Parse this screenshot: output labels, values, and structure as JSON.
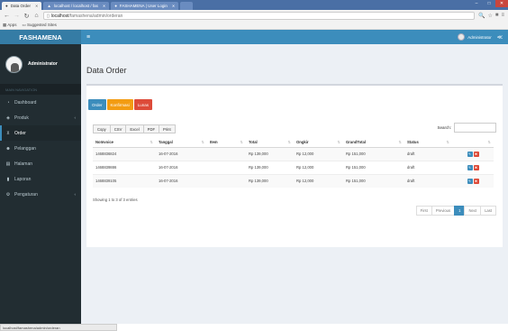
{
  "browser": {
    "tabs": [
      {
        "label": "Data Order",
        "active": true
      },
      {
        "label": "localhost / localhost / fas",
        "active": false
      },
      {
        "label": "FASHAMENA | User Login",
        "active": false
      }
    ],
    "url_host": "localhost",
    "url_path": "/famashena/admin/orderan",
    "bookmarks": [
      "Apps",
      "Suggested Sites"
    ],
    "status_url": "localhost/famashena/admin/orderan"
  },
  "header": {
    "brand": "FASHAMENA",
    "toggle_icon": "menu-icon",
    "user_name": "Administrator",
    "share_icon": "share-icon"
  },
  "sidebar": {
    "user_name": "Administrator",
    "nav_header": "MAIN NAVIGATION",
    "items": [
      {
        "label": "Dashboard",
        "icon": "dashboard-icon",
        "has_caret": false
      },
      {
        "label": "Produk",
        "icon": "tag-icon",
        "has_caret": true
      },
      {
        "label": "Order",
        "icon": "cart-icon",
        "has_caret": false
      },
      {
        "label": "Pelanggan",
        "icon": "users-icon",
        "has_caret": false
      },
      {
        "label": "Halaman",
        "icon": "page-icon",
        "has_caret": false
      },
      {
        "label": "Laporan",
        "icon": "report-icon",
        "has_caret": false
      },
      {
        "label": "Pengaturan",
        "icon": "settings-icon",
        "has_caret": true
      }
    ],
    "active_index": 2
  },
  "main": {
    "title": "Data Order",
    "tabs": [
      {
        "label": "Order",
        "color": "#3c8dbc"
      },
      {
        "label": "Konfirmasi",
        "color": "#f39c12"
      },
      {
        "label": "Lunas",
        "color": "#dd4b39"
      }
    ],
    "export_buttons": [
      "Copy",
      "CSV",
      "Excel",
      "PDF",
      "Print"
    ],
    "search_label": "Search:",
    "table": {
      "columns": [
        "NoInvoice",
        "Tanggal",
        "Item",
        "Total",
        "Ongkir",
        "GrandTotal",
        "Status",
        ""
      ],
      "rows": [
        [
          "1468836824",
          "16-07-2016",
          "",
          "Rp 139,000",
          "Rp 12,000",
          "Rp 151,000",
          "draft"
        ],
        [
          "1468839886",
          "16-07-2016",
          "",
          "Rp 139,000",
          "Rp 12,000",
          "Rp 151,000",
          "draft"
        ],
        [
          "1468839105",
          "16-07-2016",
          "",
          "Rp 139,000",
          "Rp 12,000",
          "Rp 151,000",
          "draft"
        ]
      ]
    },
    "info": "Showing 1 to 3 of 3 entries",
    "pagination": [
      "First",
      "Previous",
      "1",
      "Next",
      "Last"
    ],
    "current_page": "1"
  },
  "colors": {
    "header": "#3c8dbc",
    "brand": "#357ca5",
    "sidebar": "#222d32",
    "content_bg": "#ecf0f5"
  }
}
